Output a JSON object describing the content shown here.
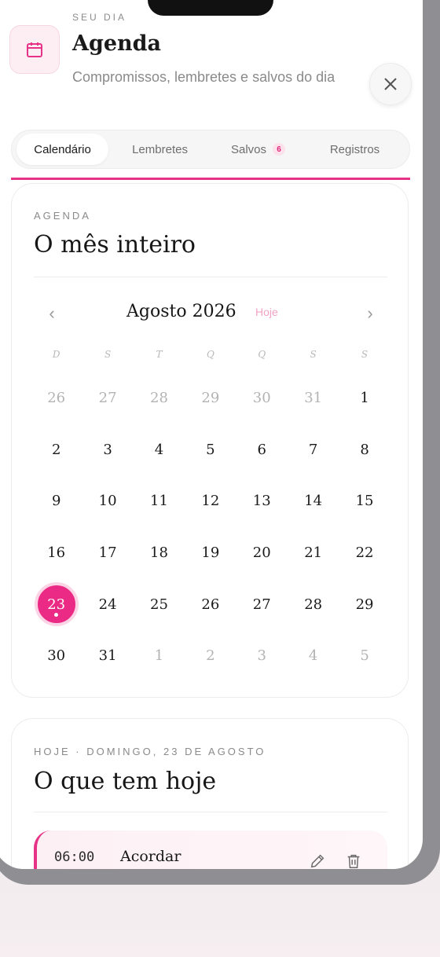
{
  "header": {
    "kicker": "SEU DIA",
    "title": "Agenda",
    "subtitle": "Compromissos, lembretes e salvos do dia",
    "icon": "calendar-icon",
    "close_icon": "close-icon"
  },
  "tabs": [
    {
      "label": "Calendário",
      "active": true
    },
    {
      "label": "Lembretes",
      "active": false
    },
    {
      "label": "Salvos",
      "active": false,
      "badge": "6"
    },
    {
      "label": "Registros",
      "active": false
    }
  ],
  "colors": {
    "accent": "#e63287",
    "today_fill": "#ea2a84",
    "muted_text": "#8a8a8a"
  },
  "calendar_card": {
    "kicker": "AGENDA",
    "title": "O mês inteiro",
    "month_label": "Agosto 2026",
    "today_button": "Hoje",
    "prev_icon": "chevron-left-icon",
    "next_icon": "chevron-right-icon",
    "weekdays": [
      "D",
      "S",
      "T",
      "Q",
      "Q",
      "S",
      "S"
    ],
    "weeks": [
      [
        {
          "d": "26",
          "other": true
        },
        {
          "d": "27",
          "other": true
        },
        {
          "d": "28",
          "other": true
        },
        {
          "d": "29",
          "other": true
        },
        {
          "d": "30",
          "other": true
        },
        {
          "d": "31",
          "other": true
        },
        {
          "d": "1"
        }
      ],
      [
        {
          "d": "2"
        },
        {
          "d": "3"
        },
        {
          "d": "4"
        },
        {
          "d": "5"
        },
        {
          "d": "6"
        },
        {
          "d": "7"
        },
        {
          "d": "8"
        }
      ],
      [
        {
          "d": "9"
        },
        {
          "d": "10"
        },
        {
          "d": "11"
        },
        {
          "d": "12"
        },
        {
          "d": "13"
        },
        {
          "d": "14"
        },
        {
          "d": "15"
        }
      ],
      [
        {
          "d": "16"
        },
        {
          "d": "17"
        },
        {
          "d": "18"
        },
        {
          "d": "19"
        },
        {
          "d": "20"
        },
        {
          "d": "21"
        },
        {
          "d": "22"
        }
      ],
      [
        {
          "d": "23",
          "today": true,
          "has_event": true
        },
        {
          "d": "24"
        },
        {
          "d": "25"
        },
        {
          "d": "26"
        },
        {
          "d": "27"
        },
        {
          "d": "28"
        },
        {
          "d": "29"
        }
      ],
      [
        {
          "d": "30"
        },
        {
          "d": "31"
        },
        {
          "d": "1",
          "other": true
        },
        {
          "d": "2",
          "other": true
        },
        {
          "d": "3",
          "other": true
        },
        {
          "d": "4",
          "other": true
        },
        {
          "d": "5",
          "other": true
        }
      ]
    ]
  },
  "today_card": {
    "kicker": "HOJE · DOMINGO, 23 DE AGOSTO",
    "title": "O que tem hoje",
    "events": [
      {
        "time": "06:00",
        "title": "Acordar",
        "edit_icon": "pencil-icon",
        "delete_icon": "trash-icon"
      }
    ]
  }
}
